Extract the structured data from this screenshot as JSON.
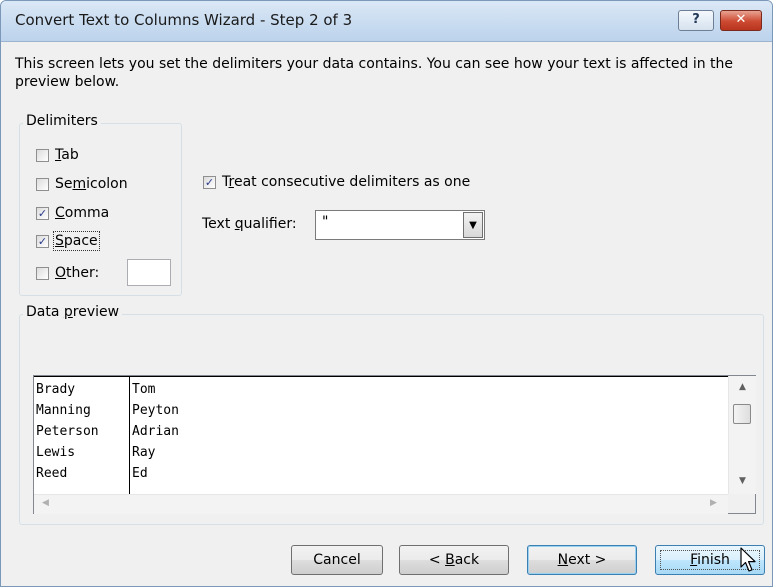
{
  "window": {
    "title": "Convert Text to Columns Wizard - Step 2 of 3",
    "help_glyph": "?",
    "close_glyph": "✕"
  },
  "description": "This screen lets you set the delimiters your data contains.  You can see how your text is affected in the preview below.",
  "delimiters": {
    "label": "Delimiters",
    "tab": {
      "label": "Tab",
      "checked": false
    },
    "semicolon": {
      "label": "Semicolon",
      "checked": false
    },
    "comma": {
      "label": "Comma",
      "checked": true
    },
    "space": {
      "label": "Space",
      "checked": true
    },
    "other": {
      "label": "Other:",
      "checked": false,
      "value": ""
    }
  },
  "consecutive": {
    "label": "Treat consecutive delimiters as one",
    "checked": true
  },
  "qualifier": {
    "label": "Text qualifier:",
    "value": "\"",
    "options": [
      "\""
    ]
  },
  "preview": {
    "label": "Data preview",
    "rows": [
      [
        "Brady",
        "Tom"
      ],
      [
        "Manning",
        "Peyton"
      ],
      [
        "Peterson",
        "Adrian"
      ],
      [
        "Lewis",
        "Ray"
      ],
      [
        "Reed",
        "Ed"
      ]
    ]
  },
  "buttons": {
    "cancel": "Cancel",
    "back": "< Back",
    "next": "Next >",
    "finish": "Finish"
  },
  "colors": {
    "accent": "#3c7fb1",
    "check": "#2a3a8c"
  }
}
